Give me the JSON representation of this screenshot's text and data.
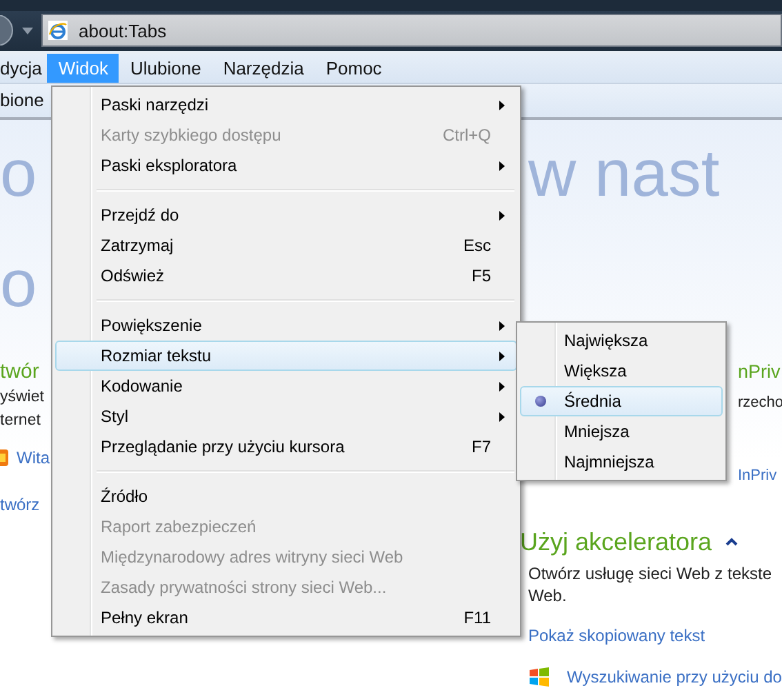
{
  "address_bar": {
    "url": "about:Tabs"
  },
  "menu_bar": [
    {
      "label": "dycja",
      "selected": false
    },
    {
      "label": "Widok",
      "selected": true
    },
    {
      "label": "Ulubione",
      "selected": false
    },
    {
      "label": "Narzędzia",
      "selected": false
    },
    {
      "label": "Pomoc",
      "selected": false
    }
  ],
  "favorites_bar": {
    "label": "bione"
  },
  "view_menu": {
    "items": [
      {
        "kind": "item",
        "label": "Paski narzędzi",
        "submenu": true,
        "disabled": false,
        "selected": false
      },
      {
        "kind": "item",
        "label": "Karty szybkiego dostępu",
        "shortcut": "Ctrl+Q",
        "submenu": false,
        "disabled": true,
        "selected": false
      },
      {
        "kind": "item",
        "label": "Paski eksploratora",
        "submenu": true,
        "disabled": false,
        "selected": false
      },
      {
        "kind": "separator"
      },
      {
        "kind": "item",
        "label": "Przejdź do",
        "submenu": true,
        "disabled": false,
        "selected": false
      },
      {
        "kind": "item",
        "label": "Zatrzymaj",
        "shortcut": "Esc",
        "submenu": false,
        "disabled": false,
        "selected": false
      },
      {
        "kind": "item",
        "label": "Odśwież",
        "shortcut": "F5",
        "submenu": false,
        "disabled": false,
        "selected": false
      },
      {
        "kind": "separator"
      },
      {
        "kind": "item",
        "label": "Powiększenie",
        "submenu": true,
        "disabled": false,
        "selected": false
      },
      {
        "kind": "item",
        "label": "Rozmiar tekstu",
        "submenu": true,
        "disabled": false,
        "selected": true
      },
      {
        "kind": "item",
        "label": "Kodowanie",
        "submenu": true,
        "disabled": false,
        "selected": false
      },
      {
        "kind": "item",
        "label": "Styl",
        "submenu": true,
        "disabled": false,
        "selected": false
      },
      {
        "kind": "item",
        "label": "Przeglądanie przy użyciu kursora",
        "shortcut": "F7",
        "submenu": false,
        "disabled": false,
        "selected": false
      },
      {
        "kind": "separator"
      },
      {
        "kind": "item",
        "label": "Źródło",
        "submenu": false,
        "disabled": false,
        "selected": false
      },
      {
        "kind": "item",
        "label": "Raport zabezpieczeń",
        "submenu": false,
        "disabled": true,
        "selected": false
      },
      {
        "kind": "item",
        "label": "Międzynarodowy adres witryny sieci Web",
        "submenu": false,
        "disabled": true,
        "selected": false
      },
      {
        "kind": "item",
        "label": "Zasady prywatności strony sieci Web...",
        "submenu": false,
        "disabled": true,
        "selected": false
      },
      {
        "kind": "item",
        "label": "Pełny ekran",
        "shortcut": "F11",
        "submenu": false,
        "disabled": false,
        "selected": false
      }
    ]
  },
  "text_size_menu": {
    "items": [
      {
        "label": "Największa",
        "checked": false,
        "selected": false
      },
      {
        "label": "Większa",
        "checked": false,
        "selected": false
      },
      {
        "label": "Średnia",
        "checked": true,
        "selected": true
      },
      {
        "label": "Mniejsza",
        "checked": false,
        "selected": false
      },
      {
        "label": "Najmniejsza",
        "checked": false,
        "selected": false
      }
    ]
  },
  "page": {
    "left": [
      {
        "kind": "big",
        "text": "o"
      },
      {
        "kind": "big",
        "text": "o"
      },
      {
        "kind": "heading",
        "text": "twór"
      },
      {
        "kind": "text",
        "text": "yświet"
      },
      {
        "kind": "text",
        "text": "ternet"
      },
      {
        "kind": "feed-link",
        "text": "Wita"
      },
      {
        "kind": "link",
        "text": "twórz"
      }
    ],
    "banner": "w nast",
    "inprivate": [
      {
        "kind": "heading",
        "text": "nPriv"
      },
      {
        "kind": "text",
        "text": "rzecho"
      },
      {
        "kind": "link",
        "text": "InPriv"
      }
    ],
    "accelerator": {
      "title": "Użyj akceleratora",
      "expanded": true,
      "lines": [
        "Otwórz usługę sieci Web z tekste",
        "Web."
      ],
      "link": "Pokaż skopiowany tekst",
      "search_link": "Wyszukiwanie przy użyciu do"
    }
  }
}
